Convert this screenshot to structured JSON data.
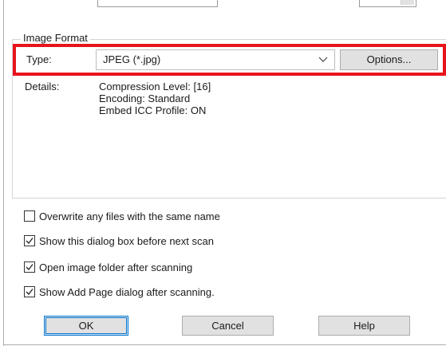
{
  "image_format": {
    "group_title": "Image Format",
    "type_label": "Type:",
    "type_value": "JPEG (*.jpg)",
    "options_label": "Options...",
    "details_label": "Details:",
    "details_lines": [
      "Compression Level: [16]",
      "Encoding: Standard",
      "Embed ICC Profile: ON"
    ]
  },
  "highlight_color": "#e8141b",
  "checkboxes": [
    {
      "label": "Overwrite any files with the same name",
      "checked": false
    },
    {
      "label": "Show this dialog box before next scan",
      "checked": true
    },
    {
      "label": "Open image folder after scanning",
      "checked": true
    },
    {
      "label": "Show Add Page dialog after scanning.",
      "checked": true
    }
  ],
  "buttons": {
    "ok": "OK",
    "cancel": "Cancel",
    "help": "Help"
  }
}
